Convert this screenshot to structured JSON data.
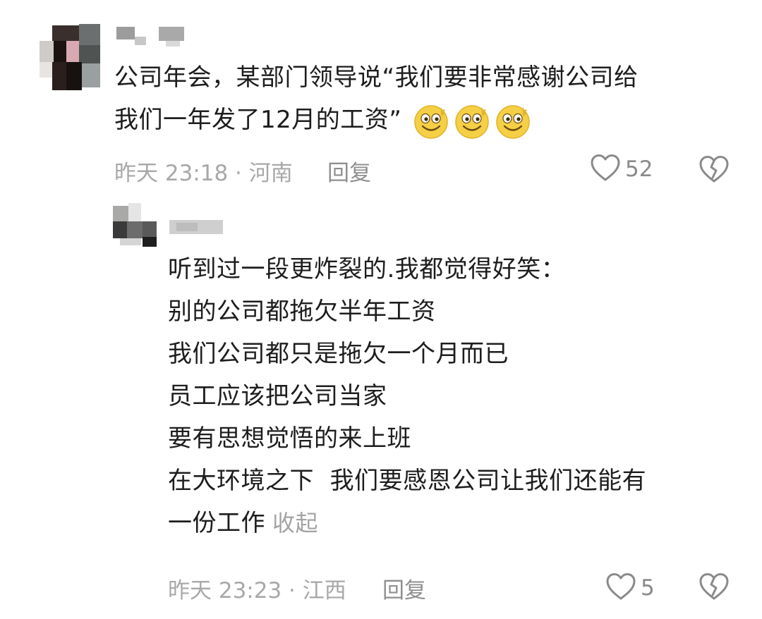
{
  "comment": {
    "text_lines": [
      "公司年会，某部门领导说“我们要非常感谢公司给",
      "我们一年发了12月的工资”"
    ],
    "emoji_icons": [
      "grinning-face-icon",
      "grinning-face-icon",
      "grinning-face-icon"
    ],
    "time_location": "昨天 23:18 · 河南",
    "reply_label": "回复",
    "like_count": "52"
  },
  "reply": {
    "text_lines": [
      "听到过一段更炸裂的.我都觉得好笑：",
      "别的公司都拖欠半年工资",
      "我们公司都只是拖欠一个月而已",
      "员工应该把公司当家",
      "要有思想觉悟的来上班",
      "在大环境之下  我们要感恩公司让我们还能有",
      "一份工作"
    ],
    "collapse_label": "收起",
    "time_location": "昨天 23:23 · 江西",
    "reply_label": "回复",
    "like_count": "5"
  },
  "colors": {
    "text": "#1d1d1d",
    "meta": "#a8a8a8",
    "icon": "#8a8a8a",
    "emoji_yellow": "#f7d44c"
  }
}
